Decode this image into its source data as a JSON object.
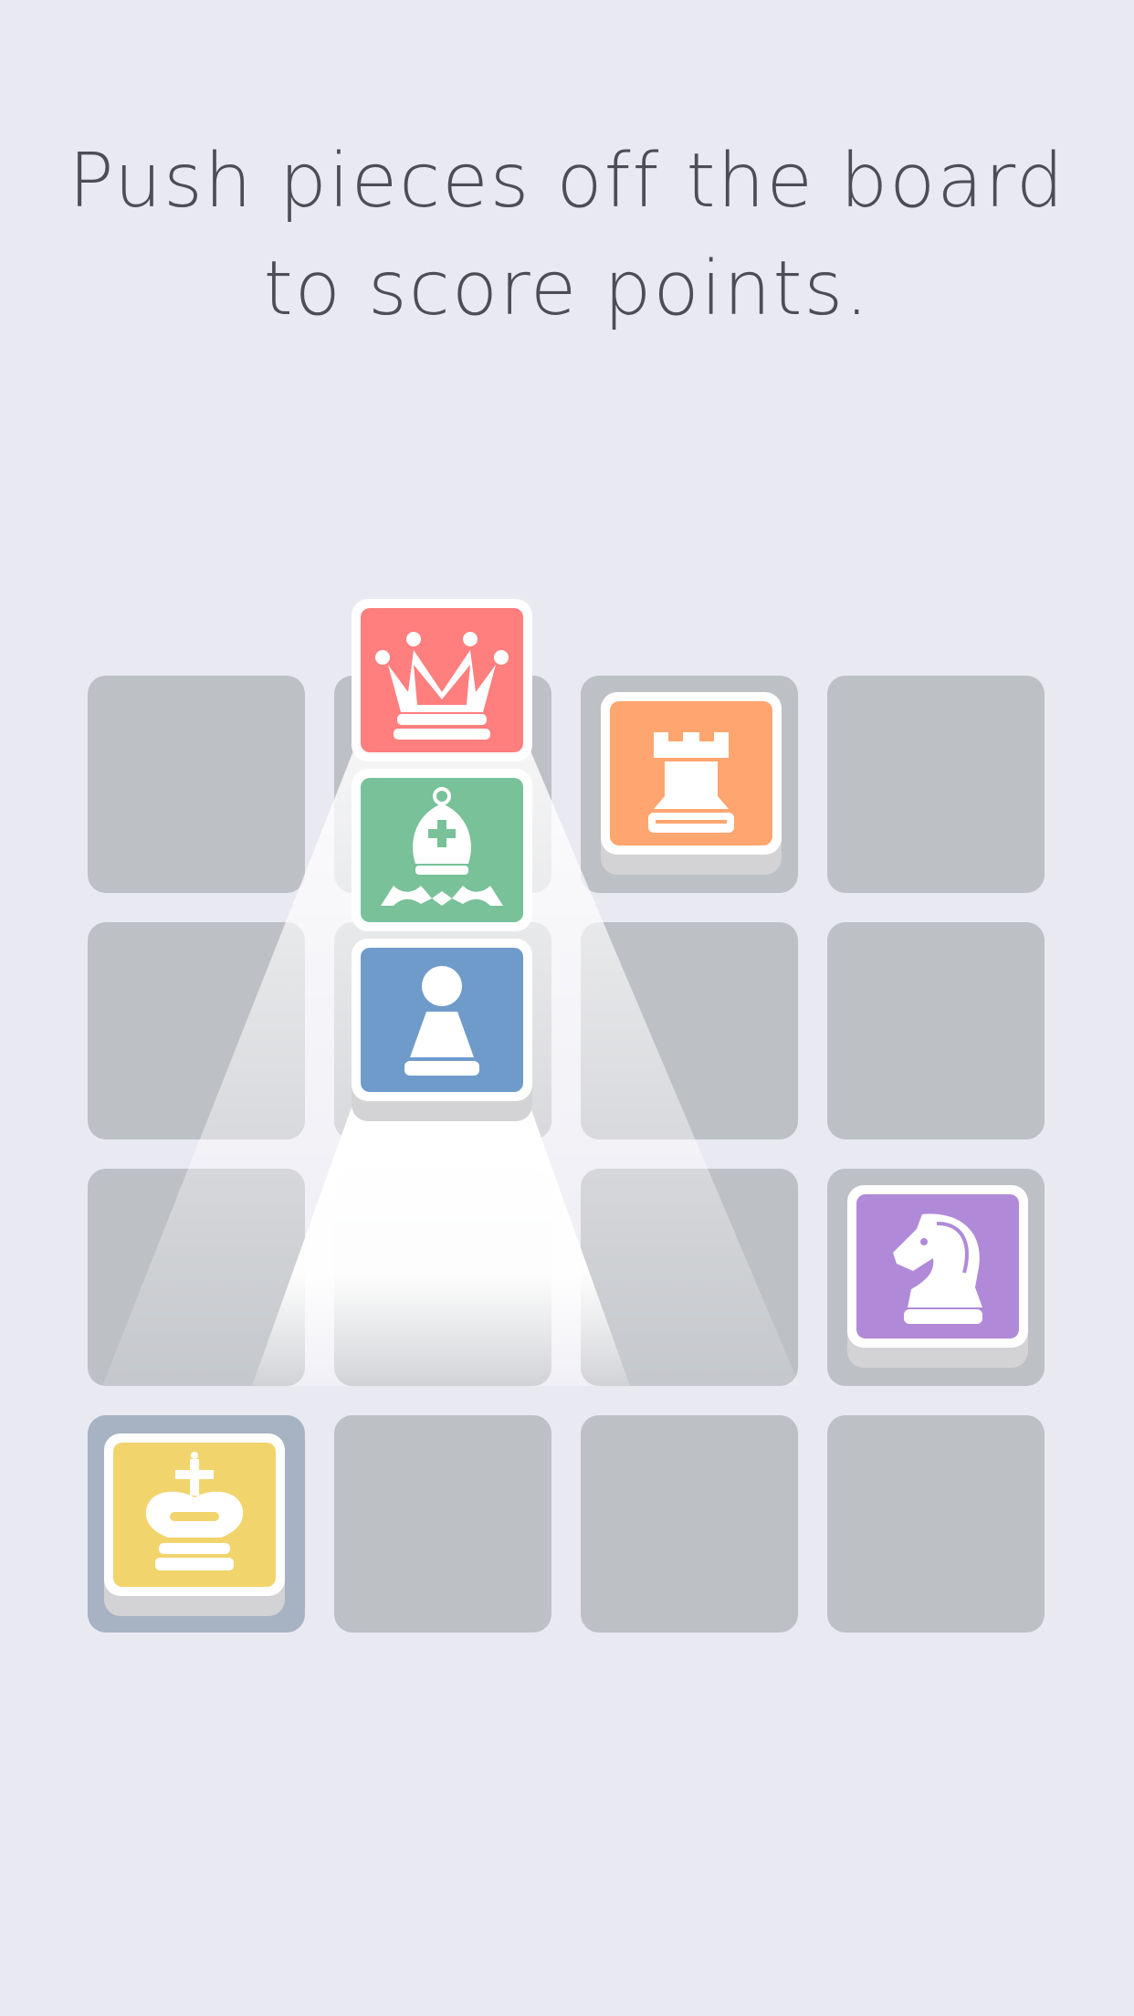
{
  "headline": {
    "line1": "Push pieces off the board",
    "line2": "to score points."
  },
  "colors": {
    "background": "#e9e9f2",
    "empty_cell": "#bdc0c5",
    "highlighted_cell": "#a7b3c3",
    "queen": "#ff7e7e",
    "bishop": "#78c199",
    "pawn": "#6f9bcb",
    "rook": "#ffa56f",
    "knight": "#b08ad9",
    "king": "#f2d46c",
    "text": "#4d4d55"
  },
  "board": {
    "size": "4x4",
    "highlighted_square": {
      "row": 4,
      "col": 1
    },
    "pieces": [
      {
        "name": "queen",
        "icon": "queen-icon",
        "row": 1,
        "col": 2,
        "lifted": true
      },
      {
        "name": "bishop",
        "icon": "bishop-icon",
        "row": 1,
        "col": 2,
        "lifted": true
      },
      {
        "name": "pawn",
        "icon": "pawn-icon",
        "row": 2,
        "col": 2,
        "lifted": true
      },
      {
        "name": "rook",
        "icon": "rook-icon",
        "row": 1,
        "col": 3,
        "lifted": false
      },
      {
        "name": "knight",
        "icon": "knight-icon",
        "row": 3,
        "col": 4,
        "lifted": false
      },
      {
        "name": "king",
        "icon": "king-icon",
        "row": 4,
        "col": 1,
        "lifted": false
      }
    ]
  }
}
